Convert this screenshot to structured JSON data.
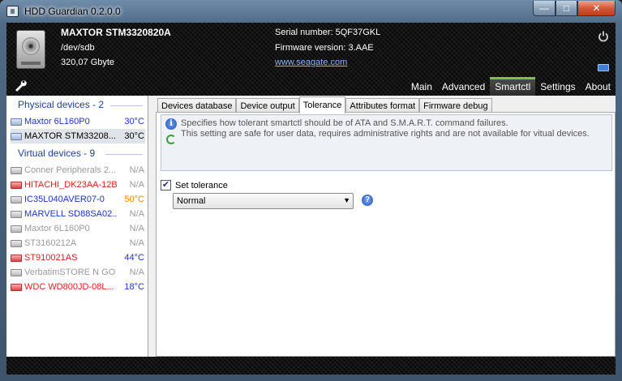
{
  "window": {
    "title": "HDD Guardian 0.2.0.0",
    "min": "—",
    "max": "□",
    "close": "✕"
  },
  "header": {
    "drive_name": "MAXTOR STM3320820A",
    "drive_path": "/dev/sdb",
    "drive_size": "320,07 Gbyte",
    "serial": "Serial number: 5QF37GKL",
    "firmware": "Firmware version: 3.AAE",
    "website": "www.seagate.com"
  },
  "menu": [
    "Main",
    "Advanced",
    "Smartctl",
    "Settings",
    "About"
  ],
  "menu_active": "Smartctl",
  "sidebar": {
    "physical_title": "Physical devices - 2",
    "virtual_title": "Virtual devices - 9",
    "physical": [
      {
        "name": "Maxtor 6L160P0",
        "temp": "30°C",
        "name_color": "#1e34c8",
        "temp_color": "#1e34c8",
        "icon": "blue"
      },
      {
        "name": "MAXTOR STM33208...",
        "temp": "30°C",
        "name_color": "#000000",
        "temp_color": "#000000",
        "icon": "blue",
        "selected": true
      }
    ],
    "virtual": [
      {
        "name": "Conner Peripherals 2...",
        "temp": "N/A",
        "name_color": "#9a9a9a",
        "temp_color": "#9a9a9a",
        "icon": "gray"
      },
      {
        "name": "HITACHI_DK23AA-12B",
        "temp": "N/A",
        "name_color": "#e02020",
        "temp_color": "#9a9a9a",
        "icon": "red"
      },
      {
        "name": "IC35L040AVER07-0",
        "temp": "50°C",
        "name_color": "#1e34c8",
        "temp_color": "#f08a00",
        "icon": "gray"
      },
      {
        "name": "MARVELL SD88SA02...",
        "temp": "N/A",
        "name_color": "#1e34c8",
        "temp_color": "#9a9a9a",
        "icon": "gray"
      },
      {
        "name": "Maxtor 6L160P0",
        "temp": "N/A",
        "name_color": "#9a9a9a",
        "temp_color": "#9a9a9a",
        "icon": "gray"
      },
      {
        "name": "ST3160212A",
        "temp": "N/A",
        "name_color": "#9a9a9a",
        "temp_color": "#9a9a9a",
        "icon": "gray"
      },
      {
        "name": "ST910021AS",
        "temp": "44°C",
        "name_color": "#e02020",
        "temp_color": "#1e34c8",
        "icon": "red"
      },
      {
        "name": "VerbatimSTORE N GO",
        "temp": "N/A",
        "name_color": "#9a9a9a",
        "temp_color": "#9a9a9a",
        "icon": "gray"
      },
      {
        "name": "WDC WD800JD-08L...",
        "temp": "18°C",
        "name_color": "#e02020",
        "temp_color": "#1e34c8",
        "icon": "red"
      }
    ]
  },
  "tabs": [
    "Devices database",
    "Device output",
    "Tolerance",
    "Attributes format",
    "Firmware debug"
  ],
  "tab_active": "Tolerance",
  "tolerance": {
    "info_line1": "Specifies how tolerant smartctl should be of ATA and S.M.A.R.T. command failures.",
    "info_line2": "This setting are safe for user data, requires administrative rights and are not available for vitual devices.",
    "checkbox_label": "Set tolerance",
    "checkbox_checked": true,
    "select_value": "Normal"
  },
  "colors": {
    "accent_green": "#7fc243",
    "link": "#8db4ff",
    "group_title": "#1e3f9c"
  }
}
